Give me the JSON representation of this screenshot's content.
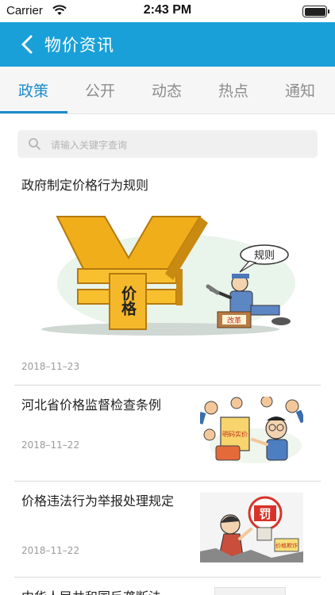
{
  "status_bar": {
    "carrier": "Carrier",
    "time": "2:43 PM"
  },
  "nav": {
    "title": "物价资讯"
  },
  "tabs": [
    {
      "label": "政策",
      "active": true
    },
    {
      "label": "公开",
      "active": false
    },
    {
      "label": "动态",
      "active": false
    },
    {
      "label": "热点",
      "active": false
    },
    {
      "label": "通知",
      "active": false
    }
  ],
  "search": {
    "placeholder": "请输入关键字查询"
  },
  "featured": {
    "title": "政府制定价格行为规则",
    "date": "2018–11–23",
    "image_text": {
      "price": "价格",
      "rules": "规则",
      "reform": "改革"
    }
  },
  "news": [
    {
      "title": "河北省价格监督检查条例",
      "date": "2018–11–22",
      "image_text": {
        "sign": "明码实价"
      }
    },
    {
      "title": "价格违法行为举报处理规定",
      "date": "2018–11–22",
      "image_text": {
        "stamp": "罚",
        "note": "价格欺诈"
      }
    },
    {
      "title": "中华人民共和国反垄断法"
    }
  ],
  "colors": {
    "accent": "#1aa0d8",
    "tab_active": "#1b8ccb"
  }
}
